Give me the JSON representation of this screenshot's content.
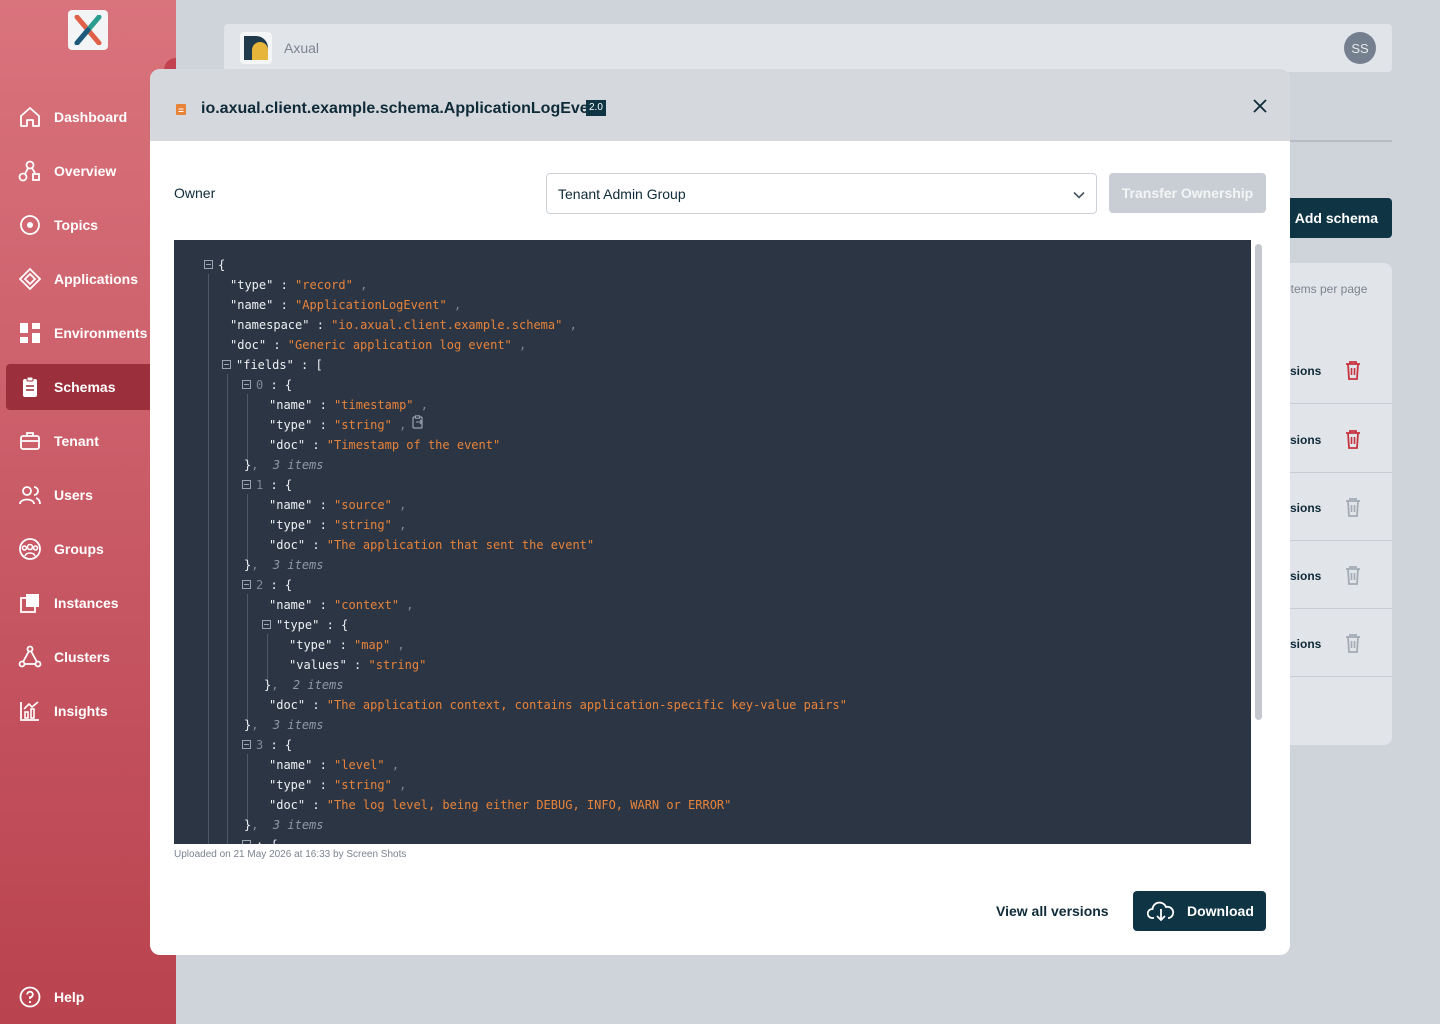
{
  "app": {
    "title": "Axual",
    "avatar_initials": "SS"
  },
  "sidebar": {
    "items": [
      {
        "label": "Dashboard",
        "icon": "home-icon"
      },
      {
        "label": "Overview",
        "icon": "overview-icon"
      },
      {
        "label": "Topics",
        "icon": "topics-icon"
      },
      {
        "label": "Applications",
        "icon": "applications-icon"
      },
      {
        "label": "Environments",
        "icon": "environments-icon"
      },
      {
        "label": "Schemas",
        "icon": "schemas-icon",
        "active": true
      },
      {
        "label": "Tenant",
        "icon": "tenant-icon"
      },
      {
        "label": "Users",
        "icon": "users-icon"
      },
      {
        "label": "Groups",
        "icon": "groups-icon"
      },
      {
        "label": "Instances",
        "icon": "instances-icon"
      },
      {
        "label": "Clusters",
        "icon": "clusters-icon"
      },
      {
        "label": "Insights",
        "icon": "insights-icon"
      }
    ],
    "help": "Help"
  },
  "background": {
    "add_schema": "Add schema",
    "items_per_page": "items per page",
    "row_label": "sions"
  },
  "modal": {
    "title": "io.axual.client.example.schema.ApplicationLogEvent",
    "version": "2.0",
    "owner_label": "Owner",
    "owner_value": "Tenant Admin Group",
    "transfer_button": "Transfer Ownership",
    "uploaded": "Uploaded on 21 May 2026 at 16:33 by Screen Shots",
    "view_all_versions": "View all versions",
    "download": "Download"
  },
  "schema": {
    "type": "record",
    "name": "ApplicationLogEvent",
    "namespace": "io.axual.client.example.schema",
    "doc": "Generic application log event",
    "fields": [
      {
        "index": "0",
        "name": "timestamp",
        "type": "string",
        "doc": "Timestamp of the event",
        "count": "3 items"
      },
      {
        "index": "1",
        "name": "source",
        "type": "string",
        "doc": "The application that sent the event",
        "count": "3 items"
      },
      {
        "index": "2",
        "name": "context",
        "type_type": "map",
        "type_values": "string",
        "type_count": "2 items",
        "doc": "The application context, contains application-specific key-value pairs",
        "count": "3 items"
      },
      {
        "index": "3",
        "name": "level",
        "type": "string",
        "doc": "The log level, being either DEBUG, INFO, WARN or ERROR",
        "count": "3 items"
      }
    ]
  },
  "colors": {
    "accent": "#0f3545",
    "sidebar": "#c75864",
    "string": "#e8833a",
    "code_bg": "#2b3543"
  }
}
